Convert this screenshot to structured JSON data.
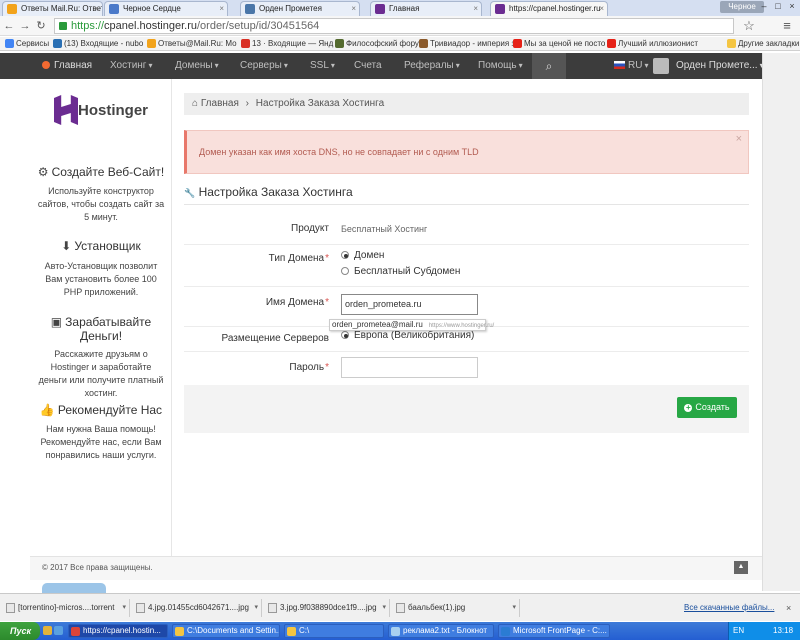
{
  "browser": {
    "tabs": [
      {
        "label": "Ответы Mail.Ru: Ответ по",
        "icon_color": "#f2a31b"
      },
      {
        "label": "Черное Сердце",
        "icon_color": "#4a79c9"
      },
      {
        "label": "Орден Прометея",
        "icon_color": "#4a76a8"
      },
      {
        "label": "Главная",
        "icon_color": "#6b2c91"
      },
      {
        "label": "https://cpanel.hostinger.ru",
        "icon_color": "#6b2c91"
      }
    ],
    "window_label": "Черное",
    "window_controls": {
      "minimize": "–",
      "maximize": "□",
      "close": "×"
    },
    "nav": {
      "back": "←",
      "forward": "→",
      "reload": "↻"
    },
    "url": {
      "scheme": "https://",
      "host": "cpanel.hostinger.ru",
      "path": "/order/setup/id/30451564"
    },
    "star": "☆",
    "menu": "≡",
    "bookmarks": [
      {
        "label": "Сервисы",
        "icon_color": "#4285f4"
      },
      {
        "label": "(13) Входящие - nubo",
        "icon_color": "#2a6fb3"
      },
      {
        "label": "Ответы@Mail.Ru: Мо",
        "icon_color": "#f2a31b"
      },
      {
        "label": "13 · Входящие — Янд",
        "icon_color": "#d93025"
      },
      {
        "label": "Философский форум",
        "icon_color": "#556b2f"
      },
      {
        "label": "Тривиадор - империя з",
        "icon_color": "#8b5a2b"
      },
      {
        "label": "Мы за ценой не посто",
        "icon_color": "#e62117"
      },
      {
        "label": "Лучший иллюзионист",
        "icon_color": "#e62117"
      }
    ],
    "other_bookmarks": "Другие закладки"
  },
  "navbar": {
    "items": [
      {
        "label": "Главная"
      },
      {
        "label": "Хостинг"
      },
      {
        "label": "Домены"
      },
      {
        "label": "Серверы"
      },
      {
        "label": "SSL"
      },
      {
        "label": "Счета"
      },
      {
        "label": "Рефералы"
      },
      {
        "label": "Помощь"
      }
    ],
    "search_icon": "⌕",
    "language": "RU",
    "user_name": "Орден Промете..."
  },
  "sidebar": {
    "logo_text": "Hostinger",
    "sections": [
      {
        "icon": "⚙",
        "title": "Создайте Веб-Сайт!",
        "text": "Используйте конструктор сайтов, чтобы создать сайт за 5 минут."
      },
      {
        "icon": "⬇",
        "title": "Установщик",
        "text": "Авто-Установщик позволит Вам установить более 100 PHP приложений."
      },
      {
        "icon": "▣",
        "title": "Зарабатывайте Деньги!",
        "text": "Расскажите друзьям о Hostinger и заработайте деньги или получите платный хостинг."
      },
      {
        "icon": "👍",
        "title": "Рекомендуйте Нас",
        "text": "Нам нужна Ваша помощь! Рекомендуйте нас, если Вам понравились наши услуги."
      }
    ]
  },
  "main": {
    "breadcrumb": {
      "home": "Главная",
      "separator": "›",
      "current": "Настройка Заказа Хостинга"
    },
    "alert": {
      "text": "Домен указан как имя хоста DNS, но не совпадает ни с одним TLD",
      "close": "×"
    },
    "form": {
      "title_icon": "🔧",
      "title": "Настройка Заказа Хостинга",
      "required_mark": "*",
      "product_label": "Продукт",
      "product_value": "Бесплатный Хостинг",
      "domain_type_label": "Тип Домена",
      "domain_type_options": [
        "Домен",
        "Бесплатный Субдомен"
      ],
      "domain_name_label": "Имя Домена",
      "domain_name_value": "orden_prometea.ru",
      "autocomplete_email": "orden_prometea@mail.ru",
      "autocomplete_source": "https://www.hostinger.ru/",
      "server_label": "Размещение Серверов",
      "server_option": "Европа (Великобритания)",
      "password_label": "Пароль",
      "password_value": "",
      "submit_label": "Создать"
    }
  },
  "page_footer": {
    "copyright": "© 2017 Все права защищены.",
    "to_top": "▲"
  },
  "downloads": {
    "items": [
      {
        "label": "[torrentino]-micros....torrent"
      },
      {
        "label": "4.jpg.01455cd6042671....jpg"
      },
      {
        "label": "3.jpg.9f038890dce1f9....jpg"
      },
      {
        "label": "баальбек(1).jpg"
      }
    ],
    "show_all": "Все скачанные файлы...",
    "close": "×"
  },
  "taskbar": {
    "start": "Пуск",
    "items": [
      {
        "label": "https://cpanel.hostin...",
        "icon_color": "#db4437"
      },
      {
        "label": "C:\\Documents and Settin...",
        "icon_color": "#f4c542"
      },
      {
        "label": "C:\\",
        "icon_color": "#f4c542"
      },
      {
        "label": "реклама2.txt - Блокнот",
        "icon_color": "#a8d0f0"
      },
      {
        "label": "Microsoft FrontPage - C:...",
        "icon_color": "#2b7cd3"
      }
    ],
    "language": "EN",
    "time": "13:18"
  }
}
